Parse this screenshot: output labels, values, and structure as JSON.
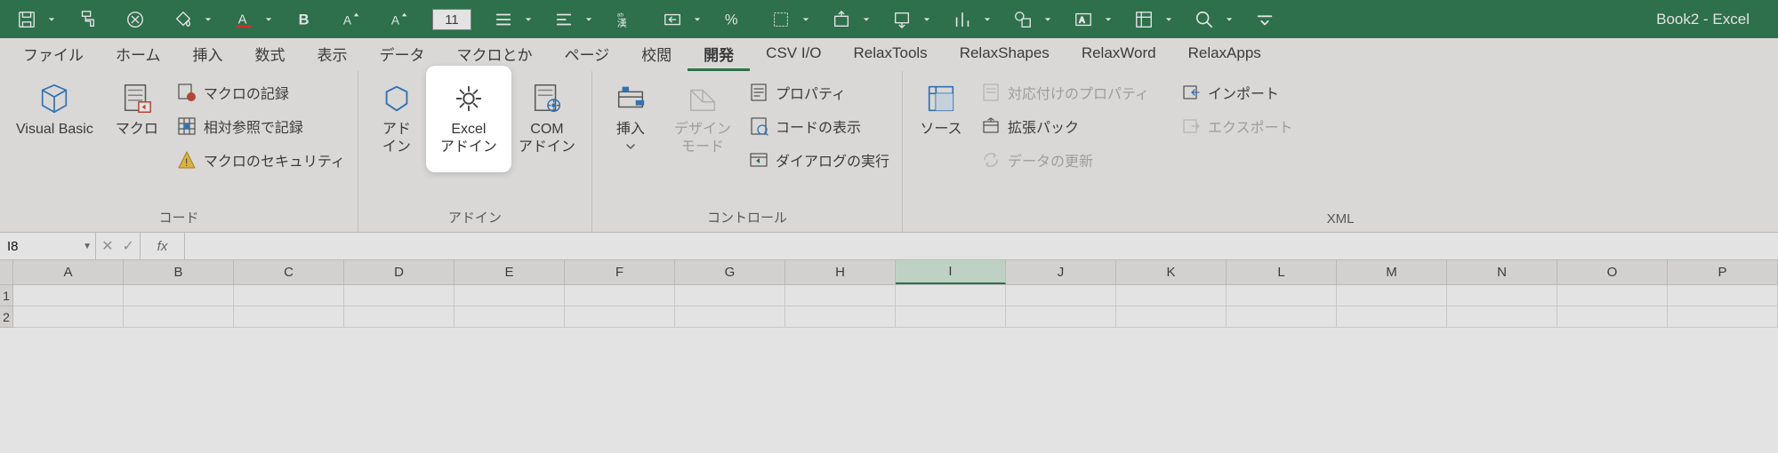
{
  "title": "Book2  -  Excel",
  "qat": {
    "font_size": "11"
  },
  "tabs": [
    "ファイル",
    "ホーム",
    "挿入",
    "数式",
    "表示",
    "データ",
    "マクロとか",
    "ページ",
    "校閲",
    "開発",
    "CSV I/O",
    "RelaxTools",
    "RelaxShapes",
    "RelaxWord",
    "RelaxApps"
  ],
  "active_tab": "開発",
  "ribbon": {
    "groups": [
      {
        "label": "コード",
        "big": [
          {
            "name": "visual-basic",
            "label": "Visual Basic"
          },
          {
            "name": "macros",
            "label": "マクロ"
          }
        ],
        "small": [
          {
            "name": "record-macro",
            "label": "マクロの記録"
          },
          {
            "name": "use-relative-refs",
            "label": "相対参照で記録"
          },
          {
            "name": "macro-security",
            "label": "マクロのセキュリティ"
          }
        ]
      },
      {
        "label": "アドイン",
        "big": [
          {
            "name": "addins",
            "label": "アド\nイン"
          },
          {
            "name": "excel-addins",
            "label": "Excel\nアドイン",
            "highlight": true
          },
          {
            "name": "com-addins",
            "label": "COM\nアドイン"
          }
        ],
        "small": []
      },
      {
        "label": "コントロール",
        "big": [
          {
            "name": "insert-control",
            "label": "挿入",
            "dropdown": true
          },
          {
            "name": "design-mode",
            "label": "デザイン\nモード",
            "disabled": true
          }
        ],
        "small": [
          {
            "name": "properties",
            "label": "プロパティ"
          },
          {
            "name": "view-code",
            "label": "コードの表示"
          },
          {
            "name": "run-dialog",
            "label": "ダイアログの実行"
          }
        ]
      },
      {
        "label": "XML",
        "big": [
          {
            "name": "source",
            "label": "ソース"
          }
        ],
        "small": [
          {
            "name": "map-properties",
            "label": "対応付けのプロパティ",
            "disabled": true
          },
          {
            "name": "expansion-packs",
            "label": "拡張パック"
          },
          {
            "name": "refresh-data",
            "label": "データの更新",
            "disabled": true
          }
        ],
        "small2": [
          {
            "name": "import",
            "label": "インポート"
          },
          {
            "name": "export",
            "label": "エクスポート",
            "disabled": true
          }
        ]
      }
    ]
  },
  "namebox": "I8",
  "columns": [
    "A",
    "B",
    "C",
    "D",
    "E",
    "F",
    "G",
    "H",
    "I",
    "J",
    "K",
    "L",
    "M",
    "N",
    "O",
    "P"
  ],
  "active_col": "I",
  "rows": [
    1,
    2
  ]
}
